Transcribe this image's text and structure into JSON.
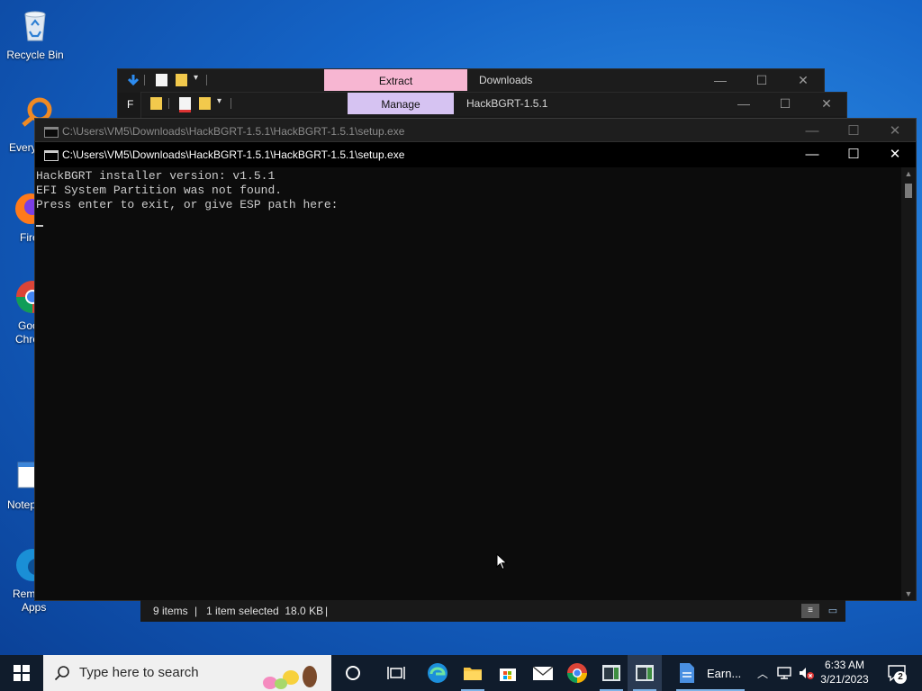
{
  "desktop": {
    "icons": [
      {
        "label": "Recycle Bin"
      },
      {
        "label": "Every"
      },
      {
        "label": "Fire"
      },
      {
        "label": "Goo",
        "label2": "Chro"
      },
      {
        "label": "Notep"
      },
      {
        "label": "Rem",
        "label2": "Apps"
      }
    ]
  },
  "explorer_back": {
    "ribbon_tab": "Extract",
    "title": "Downloads",
    "ribbon_color": "#f7b6d2"
  },
  "explorer_mid": {
    "ribbon_tab": "Manage",
    "title": "HackBGRT-1.5.1",
    "file_tab_partial": "F",
    "ribbon_color": "#d6c3f2"
  },
  "console_back": {
    "title": "C:\\Users\\VM5\\Downloads\\HackBGRT-1.5.1\\HackBGRT-1.5.1\\setup.exe"
  },
  "console": {
    "title": "C:\\Users\\VM5\\Downloads\\HackBGRT-1.5.1\\HackBGRT-1.5.1\\setup.exe",
    "lines": [
      "HackBGRT installer version: v1.5.1",
      "EFI System Partition was not found.",
      "Press enter to exit, or give ESP path here:"
    ]
  },
  "statusbar": {
    "items": "9 items",
    "selected": "1 item selected  18.0 KB"
  },
  "taskbar": {
    "search_placeholder": "Type here to search",
    "earn_label": "Earn...",
    "time": "6:33 AM",
    "date": "3/21/2023",
    "notification_count": "2"
  }
}
